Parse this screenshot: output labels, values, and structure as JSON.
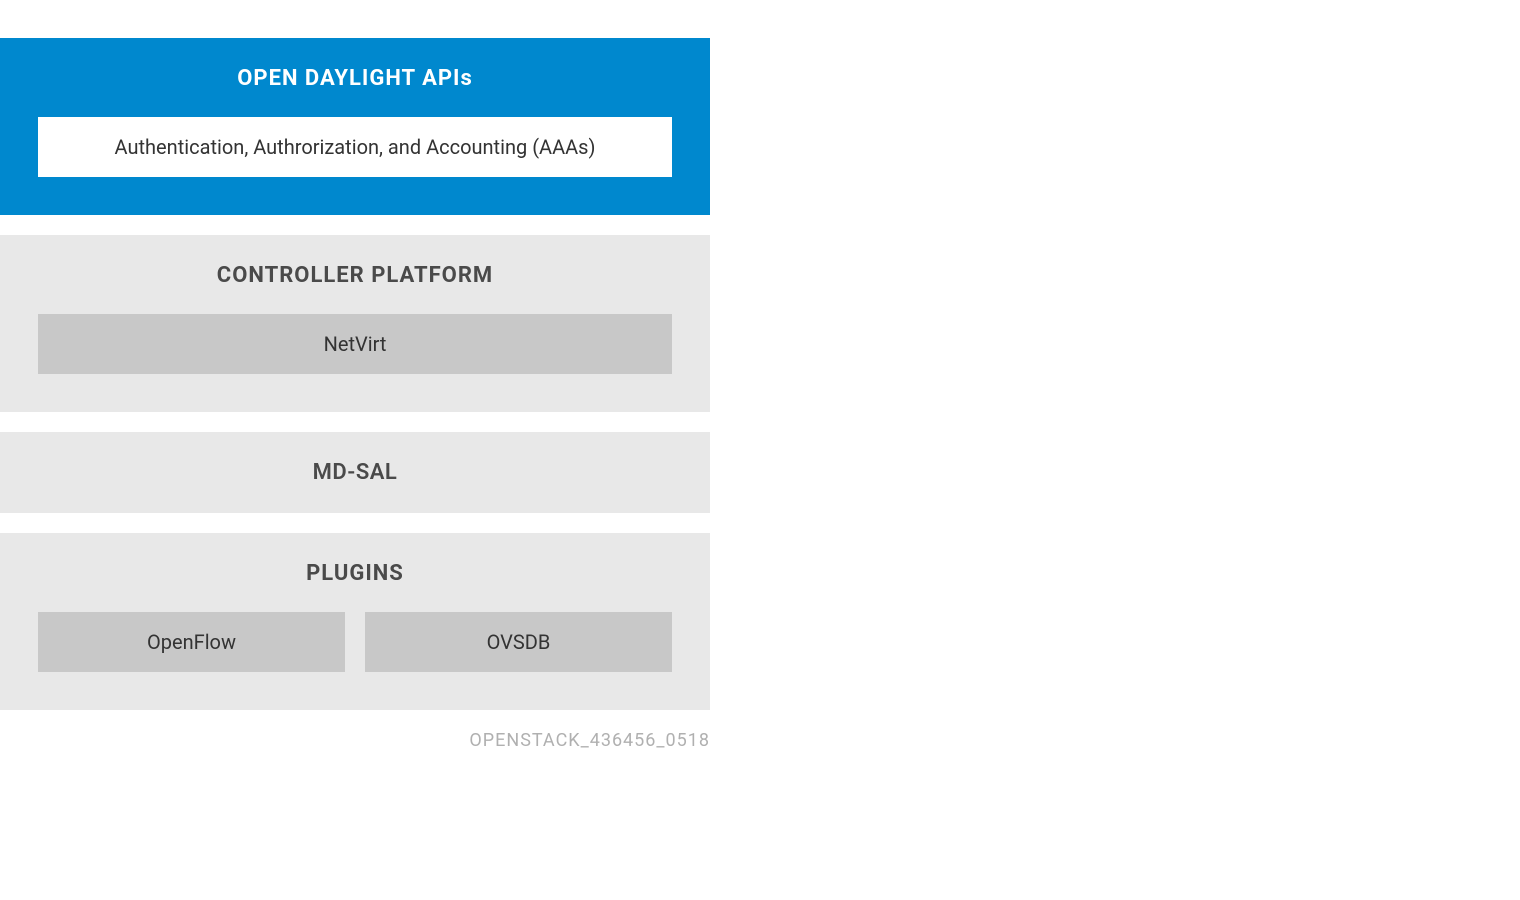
{
  "layers": {
    "apis": {
      "title": "OPEN DAYLIGHT APIs",
      "items": [
        "Authentication, Authrorization, and Accounting (AAAs)"
      ]
    },
    "controller": {
      "title": "CONTROLLER PLATFORM",
      "items": [
        "NetVirt"
      ]
    },
    "mdsal": {
      "title": "MD-SAL"
    },
    "plugins": {
      "title": "PLUGINS",
      "items": [
        "OpenFlow",
        "OVSDB"
      ]
    }
  },
  "footer_label": "OPENSTACK_436456_0518"
}
